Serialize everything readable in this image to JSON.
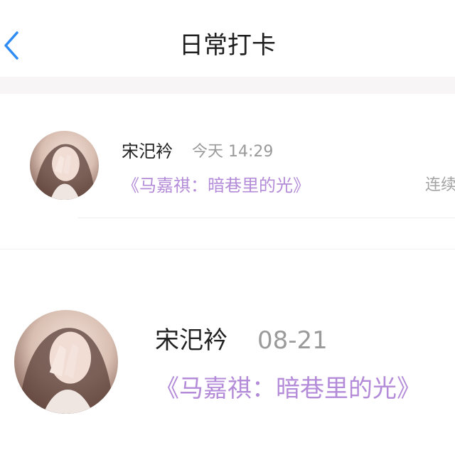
{
  "nav": {
    "title": "日常打卡",
    "back_icon": "chevron-left-icon",
    "accent_color": "#2f8bf5"
  },
  "entries": [
    {
      "user_name": "宋汜衿",
      "time": "今天 14:29",
      "book_title": "《马嘉祺：暗巷里的光》",
      "streak_text": "连续"
    },
    {
      "user_name": "宋汜衿",
      "time": "08-21",
      "book_title": "《马嘉祺：暗巷里的光》"
    }
  ],
  "colors": {
    "book_title": "#b48bd8",
    "time": "#9a9a9a",
    "name": "#222222"
  }
}
